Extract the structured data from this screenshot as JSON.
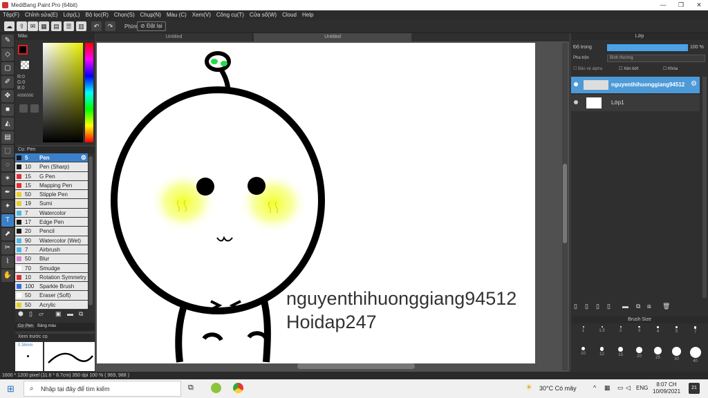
{
  "window": {
    "title": "MediBang Paint Pro (64bit)"
  },
  "menu": [
    "Tệp(F)",
    "Chỉnh sửa(E)",
    "Lớp(L)",
    "Bộ lọc(R)",
    "Chọn(S)",
    "Chụp(N)",
    "Màu (C)",
    "Xem(V)",
    "Công cụ(T)",
    "Cửa sổ(W)",
    "Cloud",
    "Help"
  ],
  "toolbar": {
    "pen_label": "Phím",
    "reset_label": "Đặt lại"
  },
  "tabs": [
    "Untitled",
    "Untitled"
  ],
  "color_panel": {
    "title": "Màu",
    "r": "R:0",
    "g": "G:0",
    "b": "B:0",
    "hex": "#000000"
  },
  "brush_panel": {
    "title": "Cọ: Pen",
    "tab1": "Cọ: Pen",
    "tab2": "Bảng màu",
    "items": [
      {
        "size": "5",
        "name": "Pen",
        "color": "#1a1a1a"
      },
      {
        "size": "10",
        "name": "Pen (Sharp)",
        "color": "#1a1a1a"
      },
      {
        "size": "15",
        "name": "G Pen",
        "color": "#e03030"
      },
      {
        "size": "15",
        "name": "Mapping Pen",
        "color": "#e03030"
      },
      {
        "size": "50",
        "name": "Stipple Pen",
        "color": "#e8d020"
      },
      {
        "size": "19",
        "name": "Sumi",
        "color": "#e8d020"
      },
      {
        "size": "7",
        "name": "Watercolor",
        "color": "#4fb8e8"
      },
      {
        "size": "17",
        "name": "Edge Pen",
        "color": "#1a1a1a"
      },
      {
        "size": "20",
        "name": "Pencil",
        "color": "#1a1a1a"
      },
      {
        "size": "90",
        "name": "Watercolor (Wet)",
        "color": "#4fb8e8"
      },
      {
        "size": "7",
        "name": "Airbrush",
        "color": "#4fb8e8"
      },
      {
        "size": "50",
        "name": "Blur",
        "color": "#e080e0"
      },
      {
        "size": "70",
        "name": "Smudge",
        "color": "#ffffff"
      },
      {
        "size": "10",
        "name": "Rotation Symmetry",
        "color": "#e03030"
      },
      {
        "size": "100",
        "name": "Sparkle Brush",
        "color": "#3070e0"
      },
      {
        "size": "50",
        "name": "Eraser (Soft)",
        "color": "#ffffff"
      },
      {
        "size": "50",
        "name": "Acrylic",
        "color": "#e8d020"
      }
    ]
  },
  "preview_panel": {
    "title": "Xem trước cọ",
    "size": "0.36mm"
  },
  "canvas_text": {
    "line1": "nguyenthihuonggiang94512",
    "line2": "Hoidap247"
  },
  "layer_panel": {
    "title": "Lớp",
    "opacity_label": "Độ trong",
    "opacity_value": "100 %",
    "blend_label": "Pha trộn",
    "blend_value": "Bình thường",
    "protect_alpha": "Bảo vệ alpha",
    "clip": "Xén bớt",
    "lock": "Khóa",
    "layers": [
      {
        "name": "nguyenthihuonggiang94512",
        "selected": true
      },
      {
        "name": "Lớp1",
        "selected": false
      }
    ]
  },
  "brush_size_panel": {
    "title": "Brush Size",
    "sizes": [
      "1",
      "1.5",
      "2",
      "3",
      "4",
      "5",
      "7",
      "10",
      "12",
      "15",
      "20",
      "25",
      "30",
      "40"
    ]
  },
  "status": {
    "text": "1600 * 1200 pixel   (11.6 * 8.7cm)   350 dpi   100 %   ( 969, 988 )"
  },
  "taskbar": {
    "search": "Nhập tại đây để tìm kiếm",
    "weather": "30°C  Có mây",
    "lang": "ENG",
    "time": "8:07 CH",
    "date": "10/09/2021",
    "notif": "21"
  }
}
